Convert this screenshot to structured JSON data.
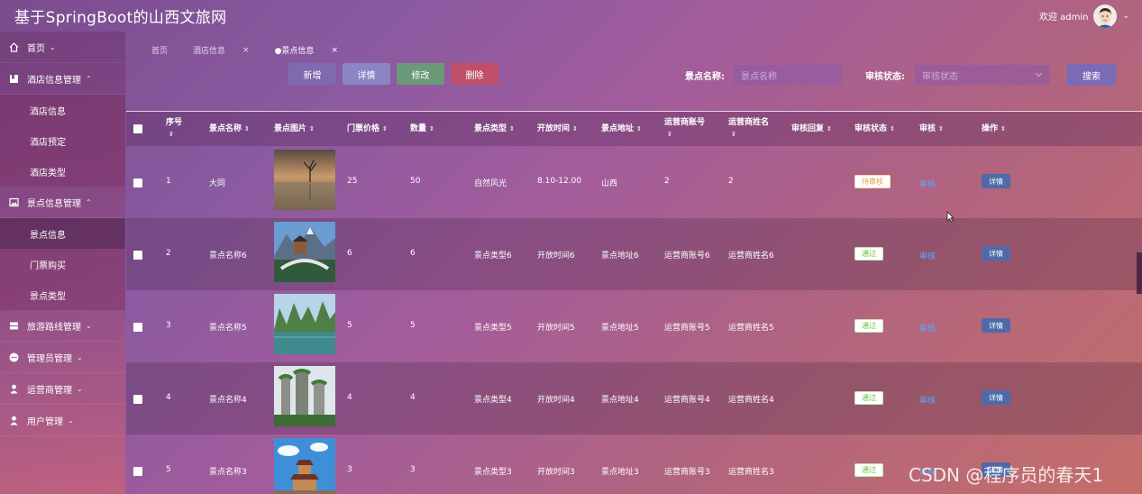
{
  "app": {
    "title": "基于SpringBoot的山西文旅网"
  },
  "header": {
    "welcome": "欢迎 admin",
    "caret": "⌄"
  },
  "sidebar": {
    "menus": [
      {
        "label": "首页",
        "icon": "home-icon",
        "chevron": "⌄"
      },
      {
        "label": "酒店信息管理",
        "icon": "bookmark-icon",
        "chevron": "⌃",
        "children": [
          "酒店信息",
          "酒店预定",
          "酒店类型"
        ]
      },
      {
        "label": "景点信息管理",
        "icon": "image-icon",
        "chevron": "⌃",
        "children": [
          "景点信息",
          "门票购买",
          "景点类型"
        ],
        "active_child": "景点信息"
      },
      {
        "label": "旅游路线管理",
        "icon": "list-icon",
        "chevron": "⌄"
      },
      {
        "label": "管理员管理",
        "icon": "dots-icon",
        "chevron": "⌄"
      },
      {
        "label": "运营商管理",
        "icon": "person-icon",
        "chevron": "⌄"
      },
      {
        "label": "用户管理",
        "icon": "person-icon",
        "chevron": "⌄"
      }
    ]
  },
  "tabs": [
    {
      "label": "首页"
    },
    {
      "label": "酒店信息",
      "close": "×"
    },
    {
      "label": "●景点信息",
      "close": "×"
    }
  ],
  "toolbar": {
    "add": "新增",
    "detail": "详情",
    "edit": "修改",
    "delete": "删除"
  },
  "filters": {
    "name_label": "景点名称:",
    "name_placeholder": "景点名称",
    "status_label": "审核状态:",
    "status_placeholder": "审核状态",
    "search": "搜索"
  },
  "table": {
    "columns": [
      "序号",
      "景点名称",
      "景点图片",
      "门票价格",
      "数量",
      "景点类型",
      "开放时间",
      "景点地址",
      "运营商账号",
      "运营商姓名",
      "审核回复",
      "审核状态",
      "审核",
      "操作"
    ],
    "rows": [
      {
        "no": "1",
        "name": "大同",
        "price": "25",
        "qty": "50",
        "type": "自然风光",
        "time": "8.10-12.00",
        "addr": "山西",
        "acct": "2",
        "owner": "2",
        "status": "待审核",
        "status_kind": "pending",
        "audit": "审核",
        "op": "详情",
        "img": "lake-tree"
      },
      {
        "no": "2",
        "name": "景点名称6",
        "price": "6",
        "qty": "6",
        "type": "景点类型6",
        "time": "开放时间6",
        "addr": "景点地址6",
        "acct": "运营商账号6",
        "owner": "运营商姓名6",
        "status": "通过",
        "status_kind": "pass",
        "audit": "审核",
        "op": "详情",
        "img": "bridge-mountain"
      },
      {
        "no": "3",
        "name": "景点名称5",
        "price": "5",
        "qty": "5",
        "type": "景点类型5",
        "time": "开放时间5",
        "addr": "景点地址5",
        "acct": "运营商账号5",
        "owner": "运营商姓名5",
        "status": "通过",
        "status_kind": "pass",
        "audit": "审核",
        "op": "详情",
        "img": "river-karst"
      },
      {
        "no": "4",
        "name": "景点名称4",
        "price": "4",
        "qty": "4",
        "type": "景点类型4",
        "time": "开放时间4",
        "addr": "景点地址4",
        "acct": "运营商账号4",
        "owner": "运营商姓名4",
        "status": "通过",
        "status_kind": "pass",
        "audit": "审核",
        "op": "详情",
        "img": "rock-pillars"
      },
      {
        "no": "5",
        "name": "景点名称3",
        "price": "3",
        "qty": "3",
        "type": "景点类型3",
        "time": "开放时间3",
        "addr": "景点地址3",
        "acct": "运营商账号3",
        "owner": "运营商姓名3",
        "status": "通过",
        "status_kind": "pass",
        "audit": "审核",
        "op": "详情",
        "img": "pagoda"
      }
    ]
  },
  "watermark": "CSDN @程序员的春天1"
}
